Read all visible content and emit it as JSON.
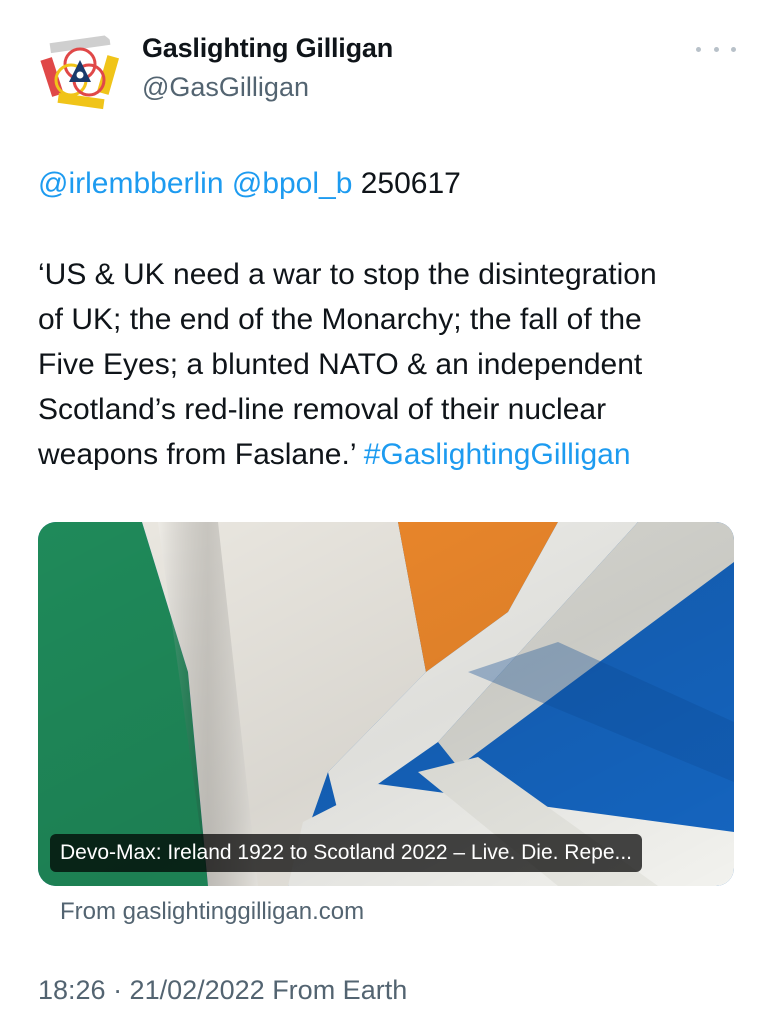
{
  "author": {
    "name": "Gaslighting Gilligan",
    "handle": "@GasGilligan",
    "avatar_icon": "triangular-knot-emblem-icon"
  },
  "tweet": {
    "mentions": [
      "@irlembberlin",
      "@bpol_b"
    ],
    "mention_suffix": "250617",
    "body_lines": [
      "‘US & UK need a war to stop the disintegration",
      "of UK; the end of the Monarchy; the fall of the",
      "Five Eyes; a blunted NATO & an independent",
      "Scotland’s red-line removal of their nuclear",
      "weapons from Faslane.’"
    ],
    "hashtag": "#GaslightingGilligan"
  },
  "card": {
    "caption": "Devo-Max: Ireland 1922 to Scotland 2022 – Live. Die. Repe...",
    "source": "From gaslightinggilligan.com",
    "image_icon": "irish-and-scottish-flags-image"
  },
  "meta": {
    "timestamp": "18:26 · 21/02/2022 From Earth"
  },
  "colors": {
    "link": "#1d9bf0",
    "muted": "#536471",
    "flag_green": "#1f8a5a",
    "flag_orange": "#f08a2c",
    "flag_blue": "#1565c0"
  }
}
